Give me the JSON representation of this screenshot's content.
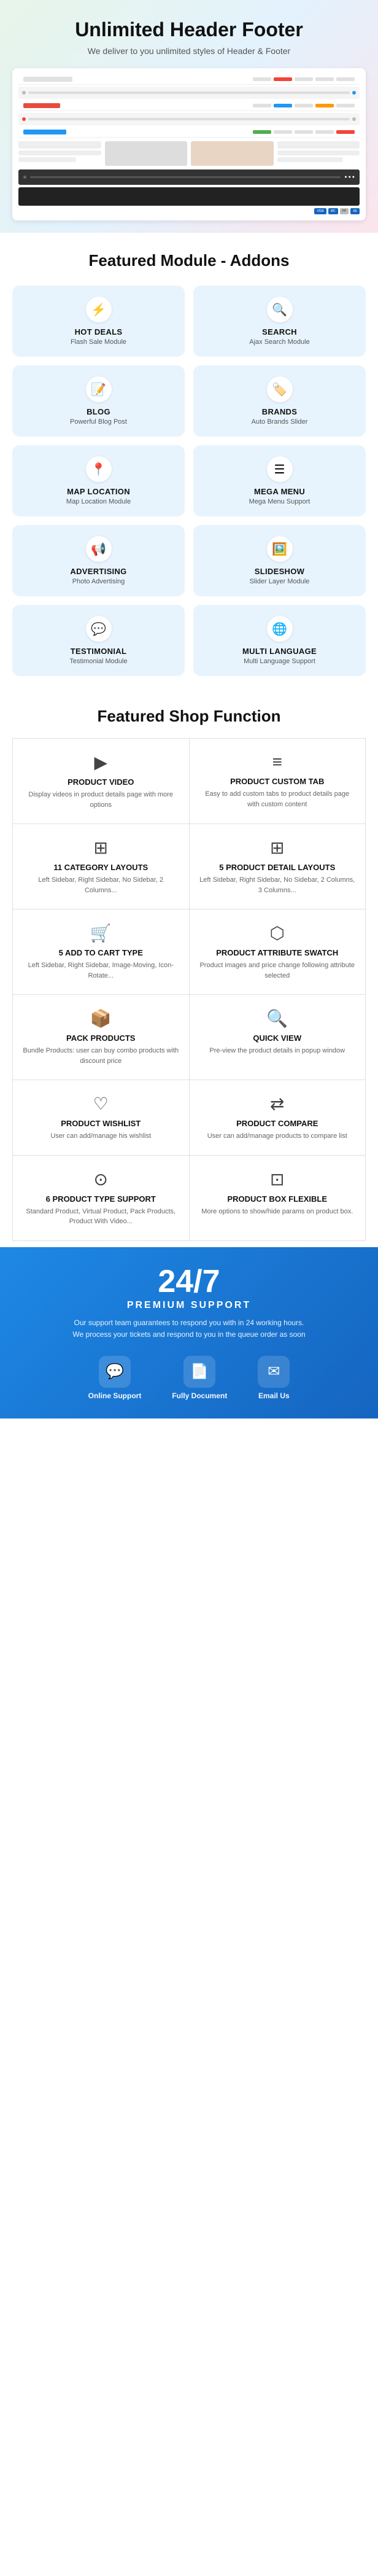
{
  "section1": {
    "title": "Unlimited Header Footer",
    "subtitle": "We deliver to you unlimited styles of Header & Footer"
  },
  "section2": {
    "title": "Featured Module - Addons",
    "modules": [
      {
        "id": "hot-deals",
        "title": "HOT DEALS",
        "subtitle": "Flash Sale Module",
        "icon": "⚡"
      },
      {
        "id": "search",
        "title": "SEARCH",
        "subtitle": "Ajax Search Module",
        "icon": "🔍"
      },
      {
        "id": "blog",
        "title": "BLOG",
        "subtitle": "Powerful Blog Post",
        "icon": "📝"
      },
      {
        "id": "brands",
        "title": "BRANDS",
        "subtitle": "Auto Brands Slider",
        "icon": "🏷️"
      },
      {
        "id": "map-location",
        "title": "MAP LOCATION",
        "subtitle": "Map Location Module",
        "icon": "📍"
      },
      {
        "id": "mega-menu",
        "title": "MEGA MENU",
        "subtitle": "Mega Menu Support",
        "icon": "☰"
      },
      {
        "id": "advertising",
        "title": "ADVERTISING",
        "subtitle": "Photo Advertising",
        "icon": "📢"
      },
      {
        "id": "slideshow",
        "title": "SLIDESHOW",
        "subtitle": "Slider Layer Module",
        "icon": "🖼️"
      },
      {
        "id": "testimonial",
        "title": "TESTIMONIAL",
        "subtitle": "Testimonial Module",
        "icon": "💬"
      },
      {
        "id": "multi-language",
        "title": "MULTI LANGUAGE",
        "subtitle": "Multi Language Support",
        "icon": "🌐"
      }
    ]
  },
  "section3": {
    "title": "Featured Shop Function",
    "items": [
      {
        "id": "product-video",
        "title": "PRODUCT VIDEO",
        "desc": "Display videos in product details page with more options",
        "icon": "▶"
      },
      {
        "id": "product-custom-tab",
        "title": "PRODUCT CUSTOM TAB",
        "desc": "Easy to add custom tabs to product details page with custom content",
        "icon": "≡"
      },
      {
        "id": "11-category-layouts",
        "title": "11 CATEGORY LAYOUTS",
        "desc": "Left Sidebar, Right Sidebar, No Sidebar, 2 Columns...",
        "icon": "⊞"
      },
      {
        "id": "5-product-detail-layouts",
        "title": "5 PRODUCT DETAIL LAYOUTS",
        "desc": "Left Sidebar, Right Sidebar, No Sidebar, 2 Columns, 3 Columns...",
        "icon": "⊞"
      },
      {
        "id": "5-add-to-cart-type",
        "title": "5 ADD TO CART TYPE",
        "desc": "Left Sidebar, Right Sidebar, Image-Moving, Icon-Rotate...",
        "icon": "🛒"
      },
      {
        "id": "product-attribute-swatch",
        "title": "PRODUCT ATTRIBUTE SWATCH",
        "desc": "Product images and price change following attribute selected",
        "icon": "⬡"
      },
      {
        "id": "pack-products",
        "title": "PACK PRODUCTS",
        "desc": "Bundle Products: user can buy combo products with discount price",
        "icon": "📦"
      },
      {
        "id": "quick-view",
        "title": "QUICK VIEW",
        "desc": "Pre-view the product details in popup window",
        "icon": "🔍"
      },
      {
        "id": "product-wishlist",
        "title": "PRODUCT WISHLIST",
        "desc": "User can add/manage his wishlist",
        "icon": "♡"
      },
      {
        "id": "product-compare",
        "title": "PRODUCT COMPARE",
        "desc": "User can add/manage products to compare list",
        "icon": "⇄"
      },
      {
        "id": "6-product-type-support",
        "title": "6 PRODUCT TYPE SUPPORT",
        "desc": "Standard Product, Virtual Product, Pack Products, Product With Video...",
        "icon": "⊙"
      },
      {
        "id": "product-box-flexible",
        "title": "PRODUCT BOX FLEXIBLE",
        "desc": "More options to show/hide params on product box.",
        "icon": "⊡"
      }
    ]
  },
  "section4": {
    "number": "24/7",
    "label": "PREMIUM SUPPORT",
    "desc1": "Our support team guarantees to respond you with in 24 working hours.",
    "desc2": "We process your tickets and respond to you in the queue order as soon",
    "items": [
      {
        "id": "online-support",
        "label": "Online Support",
        "icon": "💬"
      },
      {
        "id": "fully-document",
        "label": "Fully Document",
        "icon": "📄"
      },
      {
        "id": "email-us",
        "label": "Email Us",
        "icon": "✉"
      }
    ]
  }
}
